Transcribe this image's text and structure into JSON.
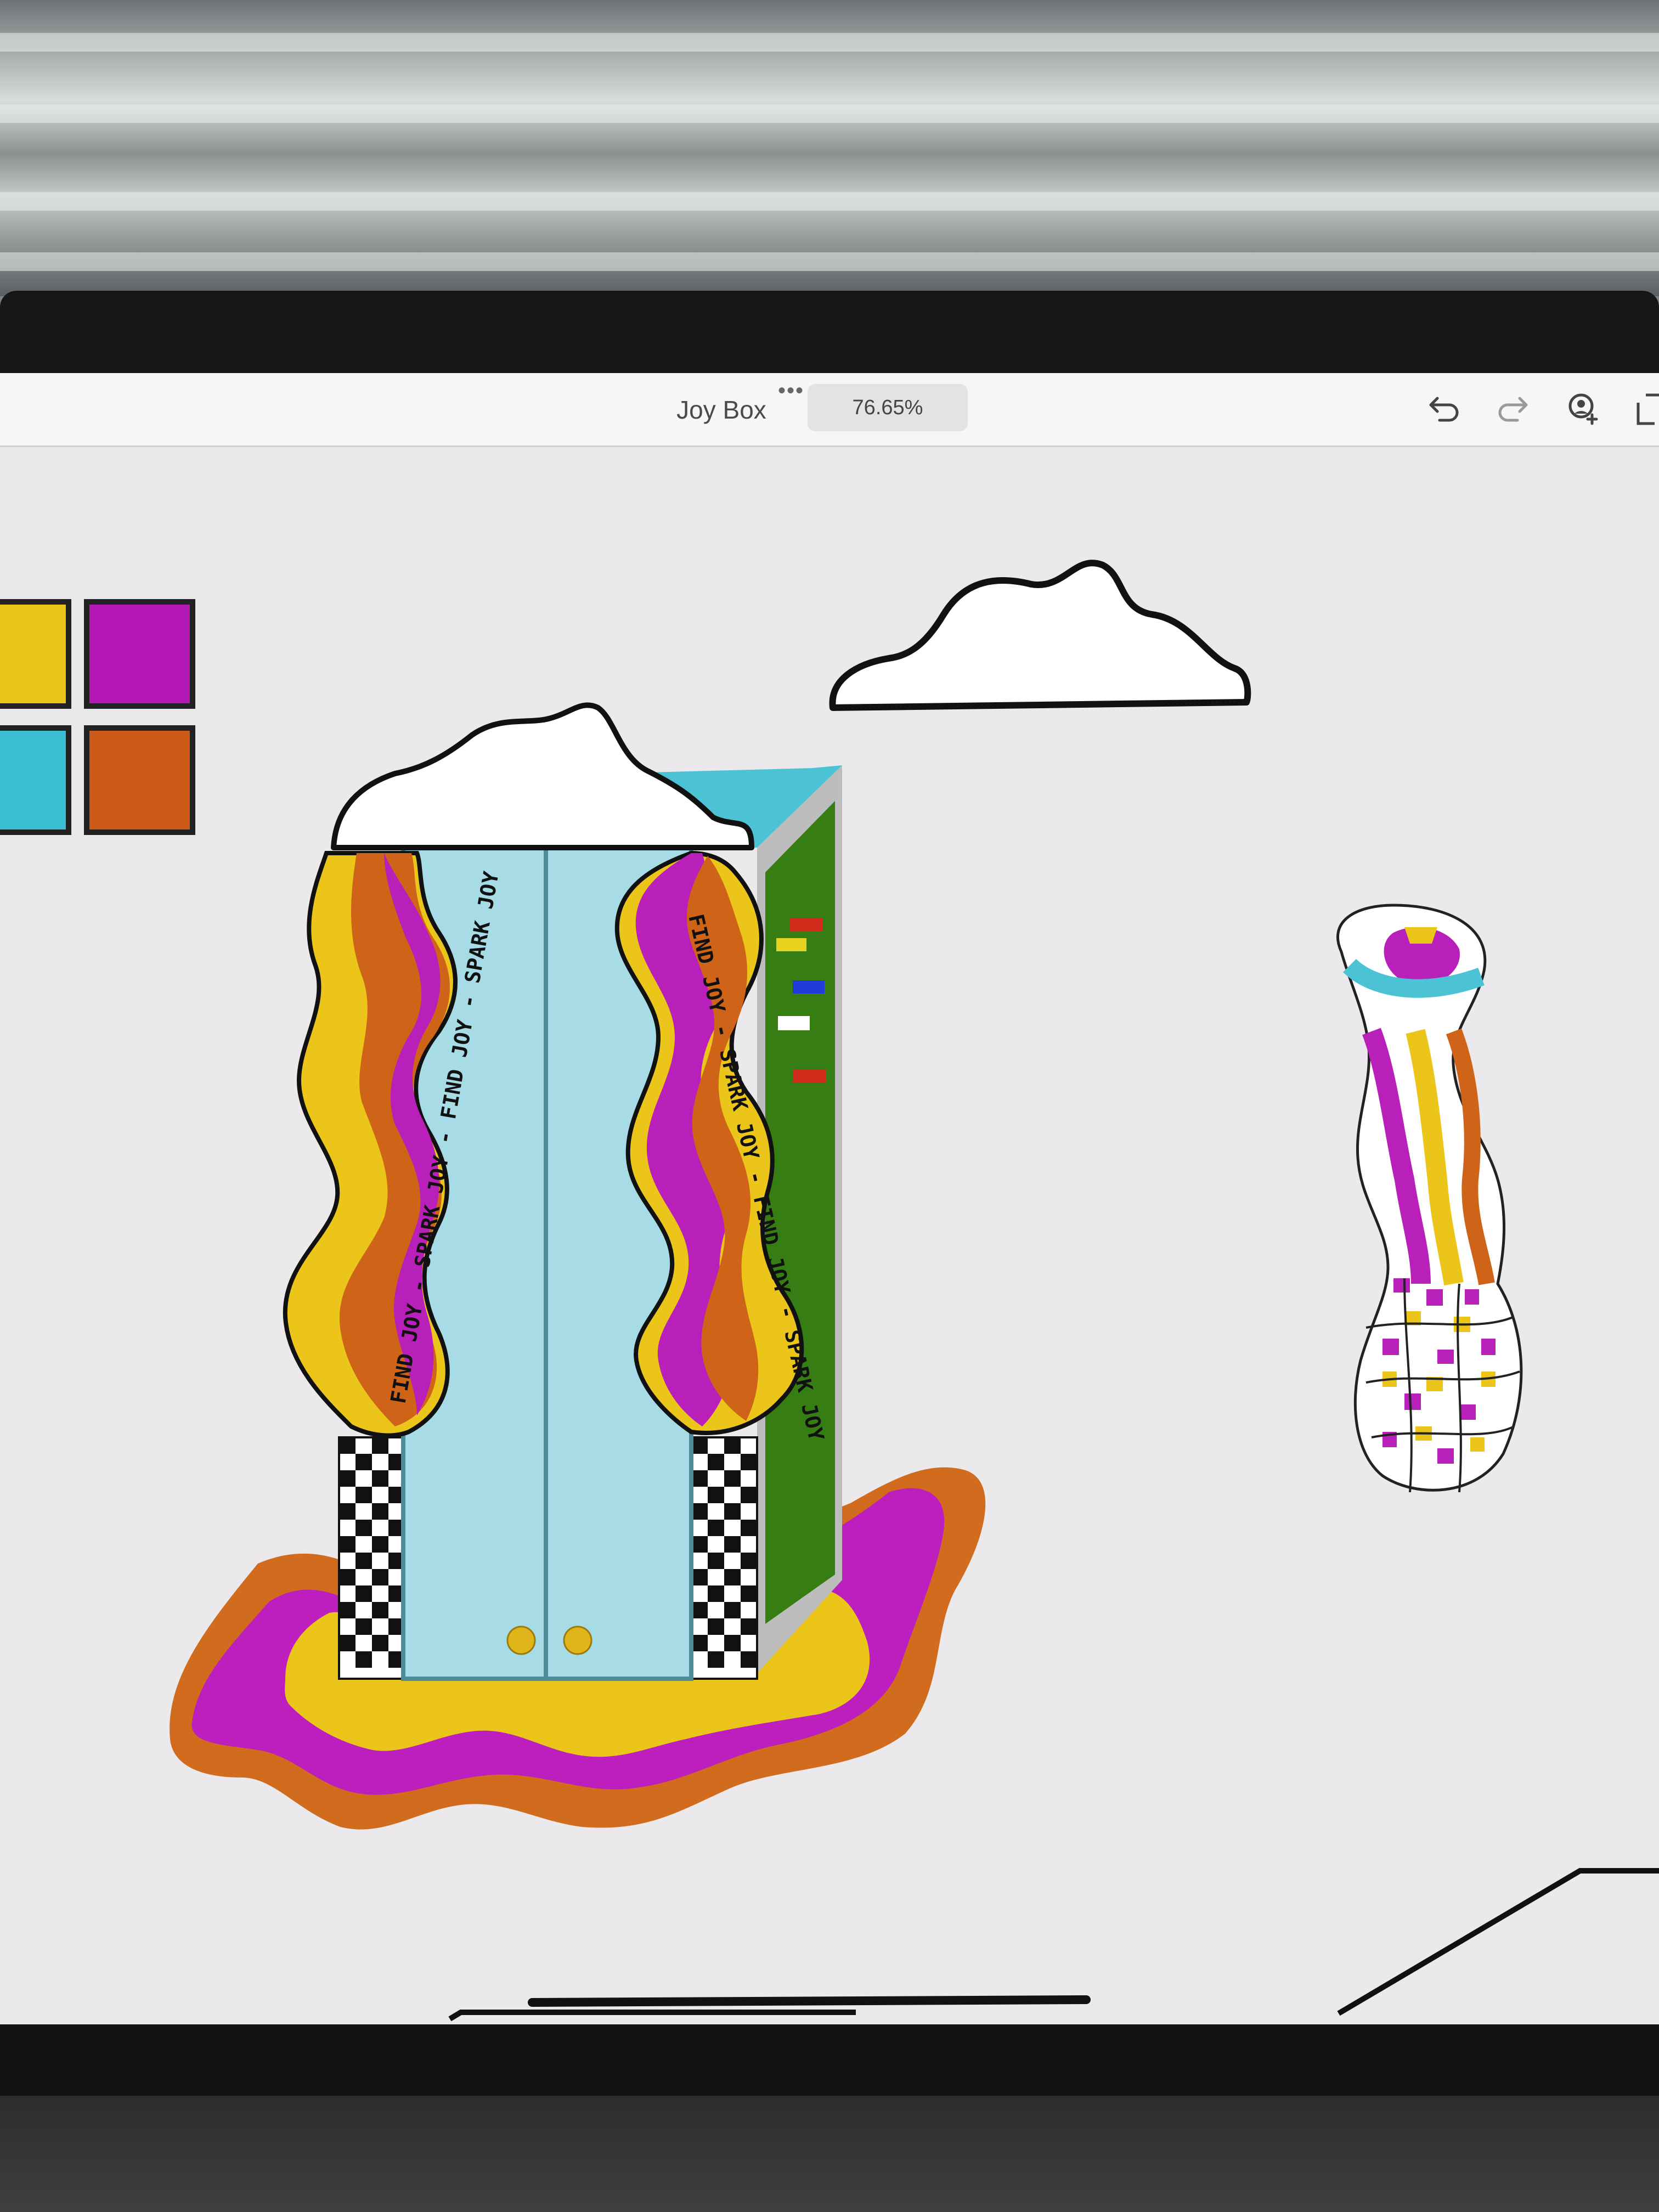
{
  "app": {
    "title": "Joy Box",
    "zoom": "76.65%"
  },
  "toolbar": {
    "more_icon": "more-dots-icon",
    "undo_icon": "undo-icon",
    "redo_icon": "redo-icon",
    "invite_icon": "person-add-icon",
    "share_icon": "share-icon"
  },
  "artwork": {
    "left_ribbon_text": "FIND JOY - SPARK JOY - FIND JOY - SPARK JOY",
    "right_ribbon_text": "FIND JOY - SPARK JOY - FIND JOY - SPARK JOY"
  },
  "palette": {
    "swatches": [
      "#e7c518",
      "#b419b5",
      "#3cbfd3",
      "#cc5a17"
    ]
  },
  "colors": {
    "yellow": "#ecc51a",
    "magenta": "#b91fb9",
    "orange": "#cf6419",
    "sky": "#a7dbe6",
    "teal": "#4bc3d5",
    "green": "#367d13",
    "gray": "#bdbdbd"
  }
}
